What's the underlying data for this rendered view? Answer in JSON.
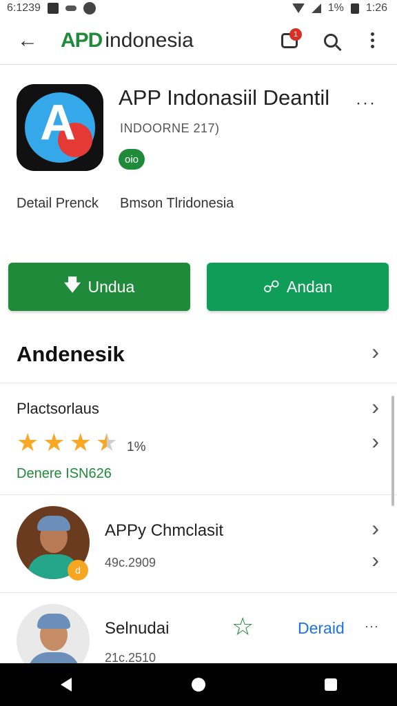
{
  "status_bar": {
    "time_left": "6:1239",
    "right_text": "1%",
    "time_right": "1:26"
  },
  "app_bar": {
    "brand_mark": "APD",
    "brand_text": "indonesia",
    "notification_count": "1"
  },
  "app": {
    "title": "APP Indonasiil Deantil",
    "subtitle": "INDOORNE 217)",
    "badge": "oio",
    "meta_left": "Detail Prenck",
    "meta_right": "Bmson Tlridonesia"
  },
  "buttons": {
    "primary": "Undua",
    "secondary": "Andan"
  },
  "section_heading": "Andenesik",
  "rating": {
    "label": "Plactsorlaus",
    "percent": "1%",
    "link": "Denere ISN626",
    "stars_value": 3.5
  },
  "items": [
    {
      "title": "APPy Chmclasit",
      "meta": "49c.2909",
      "badge": "d"
    },
    {
      "title": "Selnudai",
      "meta": "21c.2510",
      "link": "Deraid"
    }
  ],
  "colors": {
    "brand_green": "#1f8b3a",
    "action_green": "#0f9d58",
    "link_blue": "#1a73e8",
    "star_gold": "#f9a825",
    "badge_red": "#d93025"
  }
}
